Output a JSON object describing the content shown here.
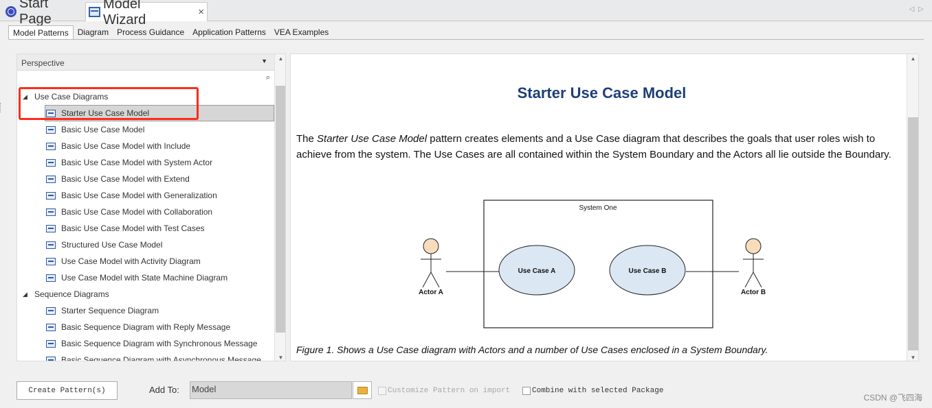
{
  "doc_tabs": [
    {
      "label": "Start Page",
      "icon": "start-page-icon"
    },
    {
      "label": "Model Wizard",
      "icon": "model-wizard-icon",
      "active": true
    }
  ],
  "close_glyph": "×",
  "sub_tabs": [
    "Model Patterns",
    "Diagram",
    "Process Guidance",
    "Application Patterns",
    "VEA Examples"
  ],
  "left": {
    "perspective_label": "Perspective",
    "dropdown_glyph": "▼",
    "search_glyph": "⌕",
    "groups": [
      {
        "label": "Use Case Diagrams",
        "items": [
          "Starter Use Case Model",
          "Basic Use Case Model",
          "Basic Use Case Model with Include",
          "Basic Use Case Model with System Actor",
          "Basic Use Case Model with Extend",
          "Basic Use Case Model with Generalization",
          "Basic Use Case Model with Collaboration",
          "Basic Use Case Model with Test Cases",
          "Structured Use Case Model",
          "Use Case Model with Activity Diagram",
          "Use Case Model with State Machine Diagram"
        ]
      },
      {
        "label": "Sequence Diagrams",
        "items": [
          "Starter Sequence Diagram",
          "Basic Sequence Diagram with Reply Message",
          "Basic Sequence Diagram with Synchronous Message",
          "Basic Sequence Diagram with Asynchronous Message"
        ]
      }
    ],
    "selected_item": "Starter Use Case Model"
  },
  "right": {
    "title": "Starter Use Case Model",
    "para_prefix": "The ",
    "para_italic": "Starter Use Case Model",
    "para_rest": " pattern creates elements and a Use Case diagram that describes the goals that user roles wish to achieve from the system. The Use Cases are all contained within the System Boundary and the Actors all lie outside the Boundary.",
    "diagram": {
      "boundary_label": "System One",
      "use_case_a": "Use Case A",
      "use_case_b": "Use Case B",
      "actor_a": "Actor A",
      "actor_b": "Actor B"
    },
    "caption": "Figure 1. Shows a Use Case diagram with Actors and a number of Use Cases enclosed in a System Boundary."
  },
  "bottom": {
    "create_button": "Create Pattern(s)",
    "add_to_label": "Add To:",
    "add_to_value": "Model",
    "customize_label": "Customize Pattern on import",
    "combine_label": "Combine with selected Package"
  },
  "watermark": "CSDN @飞四海",
  "colors": {
    "title": "#1e3f7a",
    "highlight": "#ff2a1a",
    "actor_head": "#f8dcbc",
    "use_case_fill": "#dbe7f3"
  }
}
